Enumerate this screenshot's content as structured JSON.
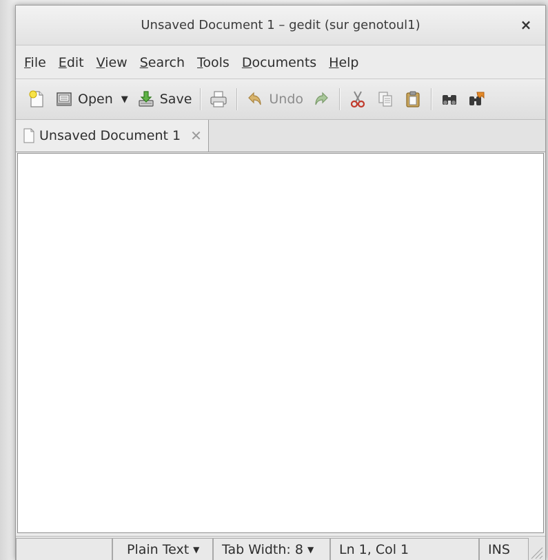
{
  "window": {
    "title": "Unsaved Document 1 – gedit (sur genotoul1)",
    "close_glyph": "×"
  },
  "menubar": {
    "items": [
      {
        "mnemonic": "F",
        "rest": "ile"
      },
      {
        "mnemonic": "E",
        "rest": "dit"
      },
      {
        "mnemonic": "V",
        "rest": "iew"
      },
      {
        "mnemonic": "S",
        "rest": "earch"
      },
      {
        "mnemonic": "T",
        "rest": "ools"
      },
      {
        "mnemonic": "D",
        "rest": "ocuments"
      },
      {
        "mnemonic": "H",
        "rest": "elp"
      }
    ]
  },
  "toolbar": {
    "new_icon": "new-document-icon",
    "open_label": "Open",
    "open_arrow": "▼",
    "save_label": "Save",
    "print_icon": "print-icon",
    "undo_label": "Undo",
    "redo_icon": "redo-icon",
    "cut_icon": "cut-icon",
    "copy_icon": "copy-icon",
    "paste_icon": "paste-icon",
    "find_icon": "find-icon",
    "replace_icon": "find-replace-icon"
  },
  "tabs": [
    {
      "label": "Unsaved Document 1",
      "close_glyph": "✕"
    }
  ],
  "editor": {
    "content": ""
  },
  "statusbar": {
    "language": "Plain Text",
    "language_arrow": "▼",
    "tab_width": "Tab Width:  8",
    "tab_width_arrow": "▼",
    "position": "Ln 1, Col 1",
    "mode": "INS"
  },
  "colors": {
    "window_bg": "#ececec",
    "editor_bg": "#ffffff",
    "save_green": "#3a8f2a",
    "undo_orange": "#c8a060"
  }
}
